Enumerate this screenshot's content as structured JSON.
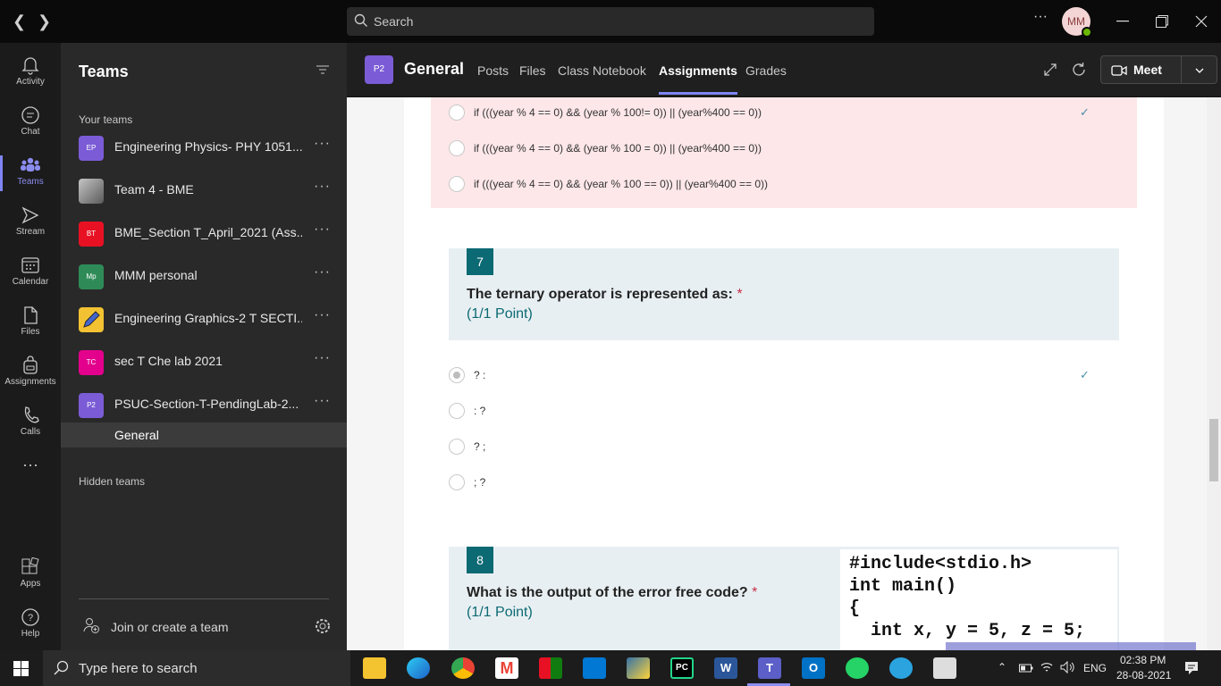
{
  "titlebar": {
    "search_placeholder": "Search",
    "more": "···",
    "avatar_initials": "MM"
  },
  "rail": [
    {
      "label": "Activity",
      "icon": "bell-icon"
    },
    {
      "label": "Chat",
      "icon": "chat-icon"
    },
    {
      "label": "Teams",
      "icon": "teams-icon",
      "active": true
    },
    {
      "label": "Stream",
      "icon": "stream-icon"
    },
    {
      "label": "Calendar",
      "icon": "calendar-icon"
    },
    {
      "label": "Files",
      "icon": "file-icon"
    },
    {
      "label": "Assignments",
      "icon": "backpack-icon"
    },
    {
      "label": "Calls",
      "icon": "phone-icon"
    },
    {
      "label": "···",
      "icon": "more-icon"
    },
    {
      "label": "Apps",
      "icon": "apps-icon"
    },
    {
      "label": "Help",
      "icon": "help-icon"
    }
  ],
  "teams_panel": {
    "title": "Teams",
    "your_teams": "Your teams",
    "hidden_teams": "Hidden teams",
    "join": "Join or create a team",
    "teams": [
      {
        "tile": "EP",
        "name": "Engineering Physics- PHY 1051...",
        "color": "#7b5cd6"
      },
      {
        "tile": "",
        "name": "Team 4 - BME",
        "color": "#8a8a8a"
      },
      {
        "tile": "BT",
        "name": "BME_Section T_April_2021 (Ass...",
        "color": "#e81123"
      },
      {
        "tile": "Mp",
        "name": "MMM personal",
        "color": "#2e8b57"
      },
      {
        "tile": "",
        "name": "Engineering Graphics-2 T SECTI...",
        "color": "#f2c233"
      },
      {
        "tile": "TC",
        "name": "sec T Che lab 2021",
        "color": "#e3008c"
      },
      {
        "tile": "P2",
        "name": "PSUC-Section-T-PendingLab-2...",
        "color": "#7b5cd6"
      }
    ],
    "active_channel": "General"
  },
  "channel_header": {
    "tile": "P2",
    "name": "General",
    "tabs": [
      "Posts",
      "Files",
      "Class Notebook",
      "Assignments",
      "Grades"
    ],
    "active_tab": "Assignments",
    "meet": "Meet"
  },
  "quiz": {
    "prev_options": [
      "if (((year % 4 == 0) && (year % 100!= 0)) || (year%400 == 0))",
      "if (((year % 4 == 0) && (year % 100 = 0)) || (year%400 == 0))",
      "if (((year % 4 == 0) && (year % 100 == 0)) || (year%400 == 0))"
    ],
    "q7": {
      "number": "7",
      "title": "The ternary operator is represented as:",
      "required": "*",
      "points": "(1/1 Point)",
      "options": [
        "? :",
        ": ?",
        "?  ;",
        ";  ?"
      ]
    },
    "q8": {
      "number": "8",
      "title": "What is the output of the error free code?",
      "required": "*",
      "points": "(1/1 Point)",
      "code": "#include<stdio.h>\nint main()\n{\n  int x, y = 5, z = 5;"
    }
  },
  "taskbar": {
    "search_placeholder": "Type here to search",
    "lang": "ENG",
    "time": "02:38 PM",
    "date": "28-08-2021"
  }
}
